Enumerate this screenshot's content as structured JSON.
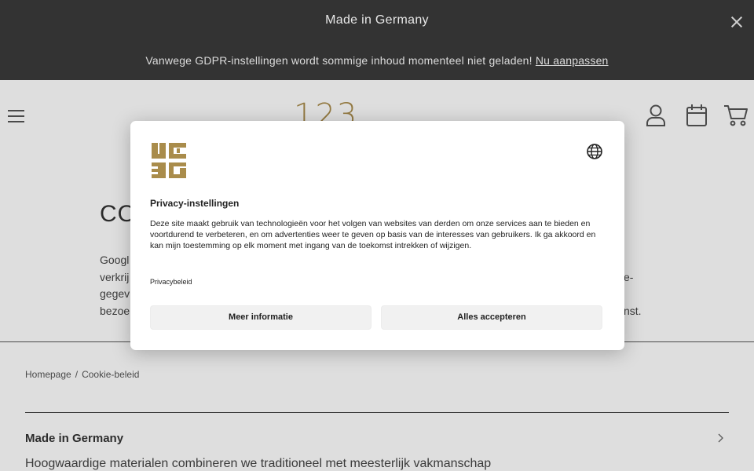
{
  "announcement": {
    "promo_text": "Made in Germany",
    "gdpr_text": "Vanwege GDPR-instellingen wordt sommige inhoud momenteel niet geladen! ",
    "gdpr_link": "Nu aanpassen"
  },
  "header": {
    "logo_text": "123 GOLD",
    "icons": [
      "menu-icon",
      "account-icon",
      "calendar-icon",
      "cart-icon"
    ]
  },
  "content": {
    "title": "CO",
    "body_lines": [
      "Googl",
      "verkrij",
      "gegev",
      "bezoe"
    ],
    "body_tail": [
      "e-",
      "nst."
    ]
  },
  "breadcrumb": {
    "home": "Homepage",
    "separator": "/",
    "current": "Cookie-beleid"
  },
  "footer": {
    "accordion_title": "Made in Germany",
    "accordion_text": "Hoogwaardige materialen combineren we traditioneel met meesterlijk vakmanschap"
  },
  "modal": {
    "title": "Privacy-instellingen",
    "description": "Deze site maakt gebruik van technologieën voor het volgen van websites van derden om onze services aan te bieden en voortdurend te verbeteren, en om advertenties weer te geven op basis van de interesses van gebruikers. Ik ga akkoord en kan mijn toestemming op elk moment met ingang van de toekomst intrekken of wijzigen.",
    "policy_link": "Privacybeleid",
    "more_info_button": "Meer informatie",
    "accept_all_button": "Alles accepteren"
  },
  "colors": {
    "topbar_bg": "#333333",
    "brand_gold": "#a98c4b",
    "button_bg": "#f1f1f1"
  }
}
